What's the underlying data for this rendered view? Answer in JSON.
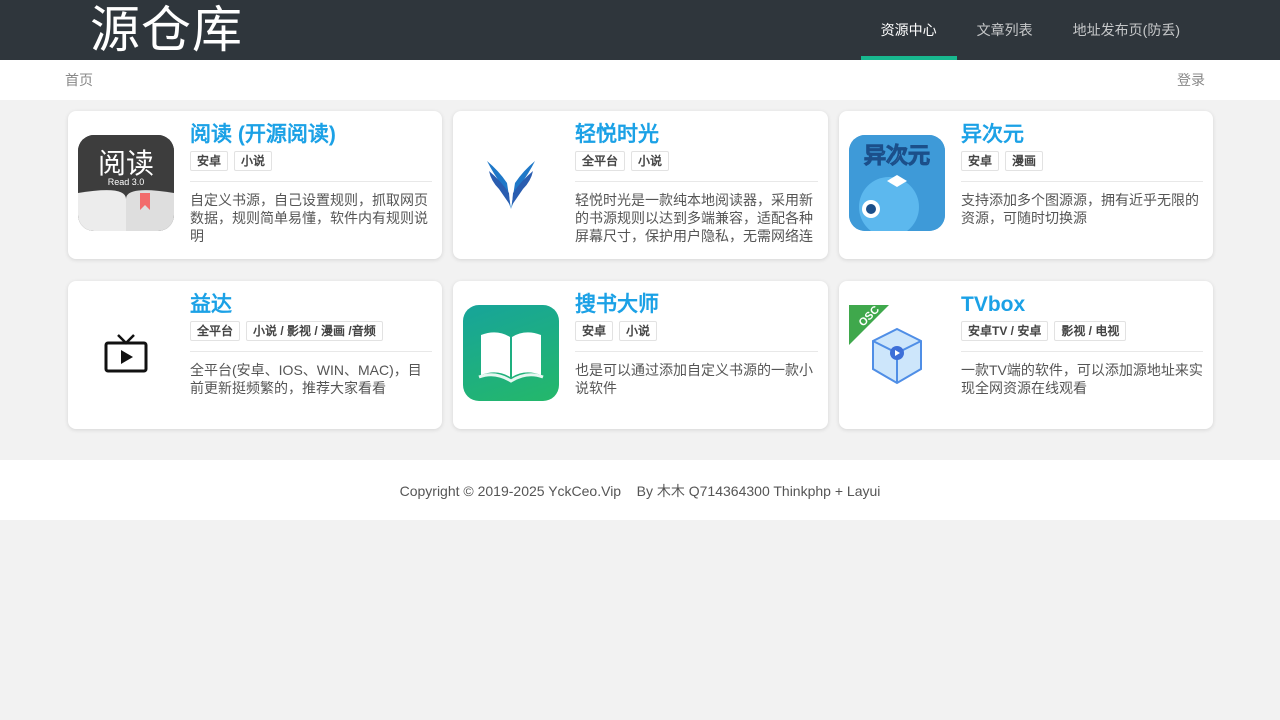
{
  "header": {
    "logo": "源仓库",
    "nav": [
      "资源中心",
      "文章列表",
      "地址发布页(防丢)"
    ]
  },
  "subbar": {
    "breadcrumb": "首页",
    "login": "登录"
  },
  "cards": [
    {
      "title": "阅读 (开源阅读)",
      "tags": [
        "安卓",
        "小说"
      ],
      "desc": "自定义书源，自己设置规则，抓取网页数据，规则简单易懂，软件内有规则说明",
      "icon": "read-app-icon",
      "icon_text": "阅读",
      "icon_sub": "Read 3.0"
    },
    {
      "title": "轻悦时光",
      "tags": [
        "全平台",
        "小说"
      ],
      "desc": "轻悦时光是一款纯本地阅读器，采用新的书源规则以达到多端兼容，适配各种屏幕尺寸，保护用户隐私，无需网络连接即可阅读",
      "icon": "wings-icon"
    },
    {
      "title": "异次元",
      "tags": [
        "安卓",
        "漫画"
      ],
      "desc": "支持添加多个图源源，拥有近乎无限的资源，可随时切换源",
      "icon": "anime-girl-icon",
      "icon_text": "异次元"
    },
    {
      "title": "益达",
      "tags": [
        "全平台",
        "小说 / 影视 / 漫画 /音频"
      ],
      "desc": "全平台(安卓、IOS、WIN、MAC)，目前更新挺频繁的，推荐大家看看",
      "icon": "tv-play-icon"
    },
    {
      "title": "搜书大师",
      "tags": [
        "安卓",
        "小说"
      ],
      "desc": "也是可以通过添加自定义书源的一款小说软件",
      "icon": "open-book-icon"
    },
    {
      "title": "TVbox",
      "tags": [
        "安卓TV / 安卓",
        "影视 / 电视"
      ],
      "desc": "一款TV端的软件，可以添加源地址来实现全网资源在线观看",
      "icon": "tv-box-cube-icon",
      "icon_text": "OSC"
    }
  ],
  "footer": {
    "text": "Copyright © 2019-2025 YckCeo.Vip    By 木木 Q714364300 Thinkphp + Layui"
  },
  "colors": {
    "topbar": "#2f363c",
    "accent": "#18b88f",
    "title": "#1ba1e6"
  }
}
